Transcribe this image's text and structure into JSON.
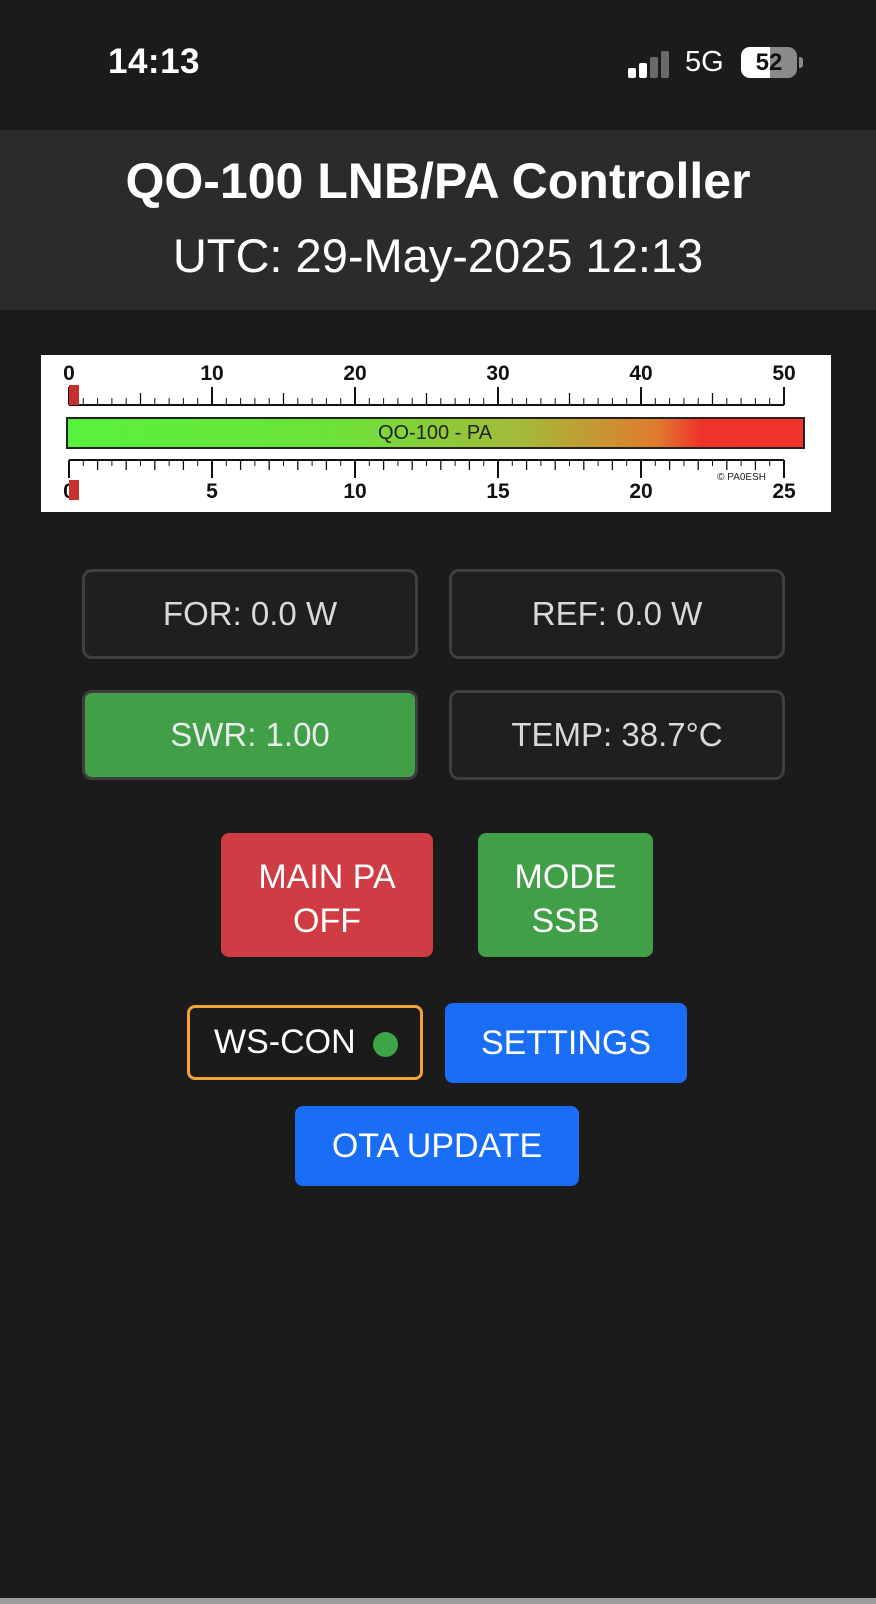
{
  "status_bar": {
    "time": "14:13",
    "network": "5G",
    "battery_level": "52",
    "battery_fraction": 0.52,
    "signal_bars_active": 2,
    "signal_bars_total": 4
  },
  "header": {
    "title": "QO-100 LNB/PA Controller",
    "utc": "UTC: 29-May-2025 12:13"
  },
  "meter": {
    "label": "QO-100 - PA",
    "copyright": "© PA0ESH",
    "top_scale": [
      "0",
      "10",
      "20",
      "30",
      "40",
      "50"
    ],
    "bottom_scale": [
      "0",
      "5",
      "10",
      "15",
      "20",
      "25"
    ],
    "top_needle_value": 0,
    "bottom_needle_value": 0
  },
  "readouts": {
    "forward": "FOR: 0.0 W",
    "reflected": "REF: 0.0 W",
    "swr": "SWR: 1.00",
    "temp": "TEMP: 38.7°C"
  },
  "buttons": {
    "main_pa_line1": "MAIN PA",
    "main_pa_line2": "OFF",
    "mode_line1": "MODE",
    "mode_line2": "SSB",
    "ws_con": "WS-CON",
    "settings": "SETTINGS",
    "ota_update": "OTA UPDATE"
  },
  "colors": {
    "background": "#1b1b1b",
    "header_bg": "#2b2b2b",
    "pa_off": "#cf3c43",
    "mode_ssb": "#41a047",
    "swr_ok": "#41a047",
    "ws_border": "#f0a33a",
    "ws_dot": "#3fa34a",
    "primary_button": "#1a6ef5"
  }
}
